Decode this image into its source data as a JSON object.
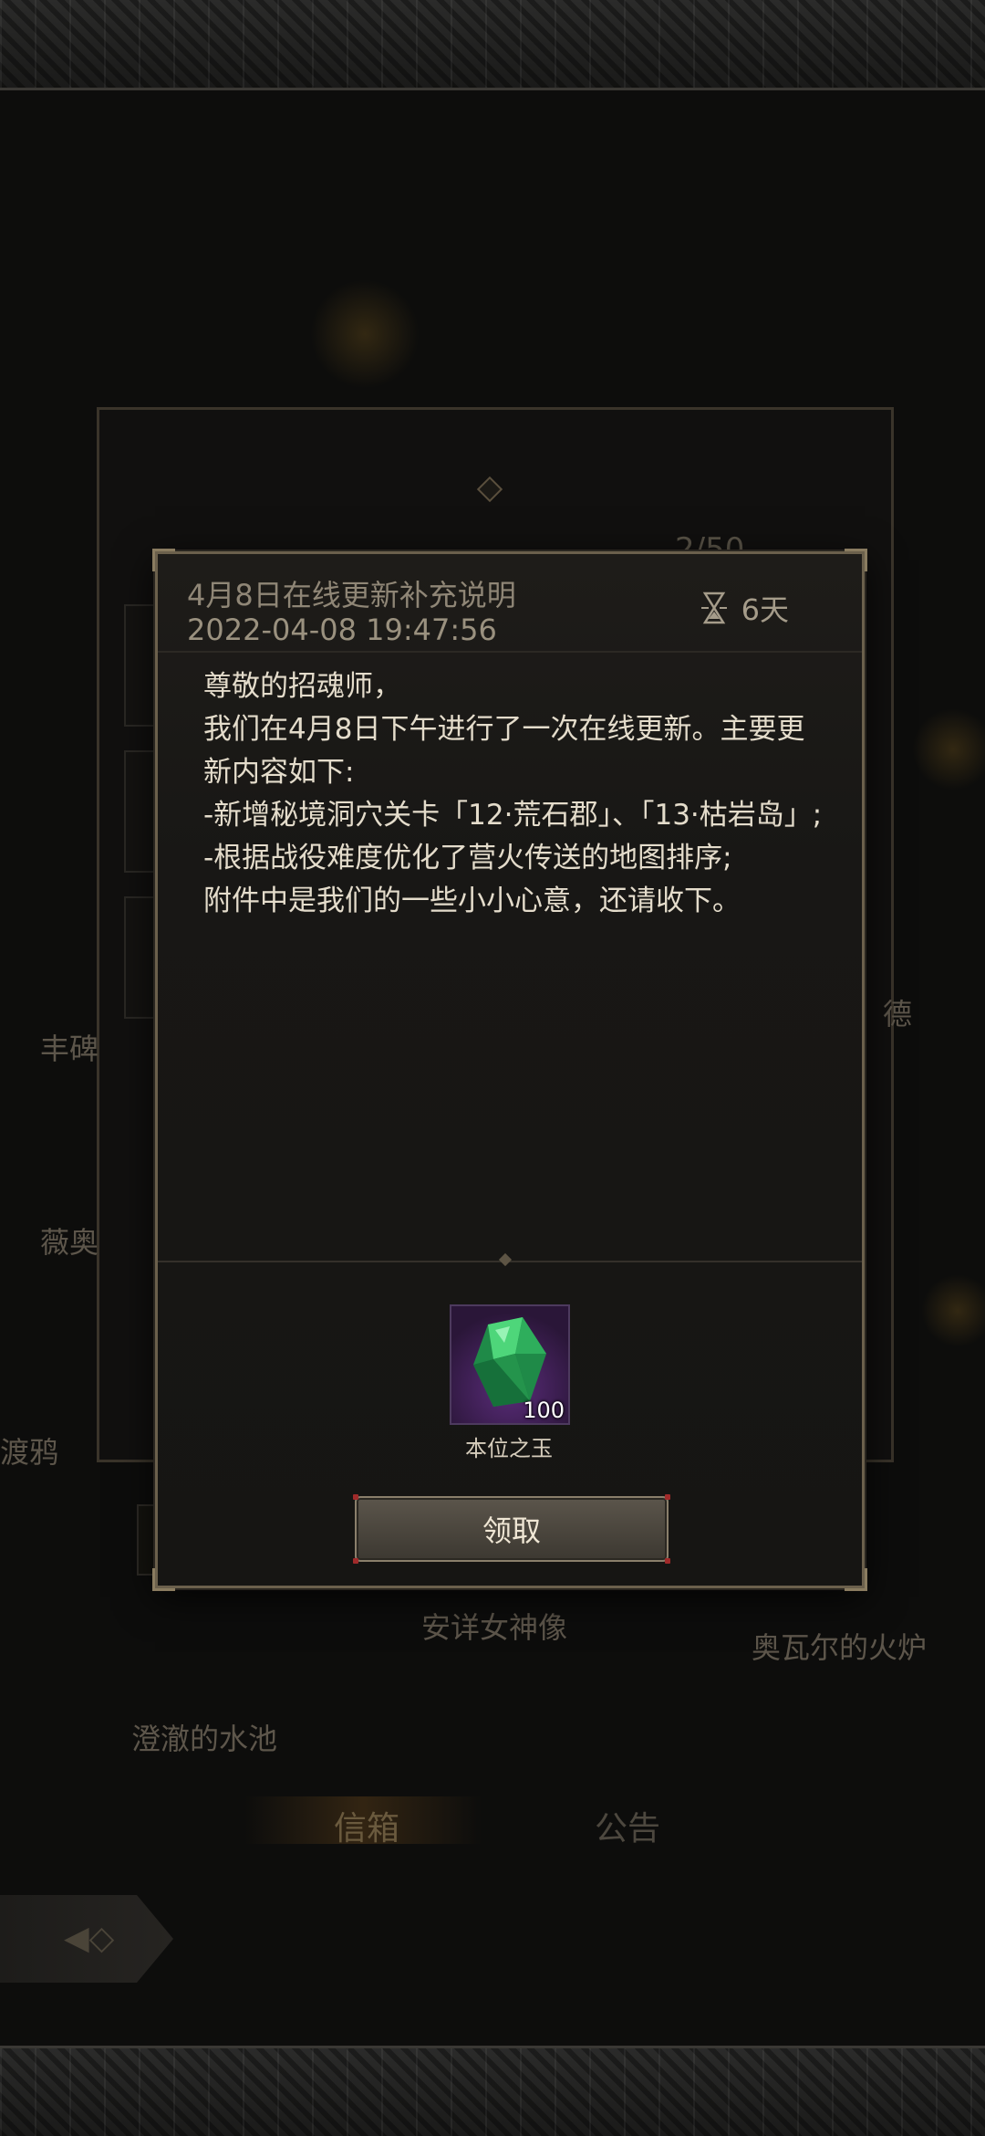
{
  "background": {
    "counter": "2/50",
    "side_labels": [
      "丰碑",
      "薇奥",
      "渡鸦",
      "德"
    ],
    "locations": [
      "安详女神像",
      "奥瓦尔的火炉",
      "澄澈的水池"
    ],
    "tabs": [
      {
        "label": "信箱",
        "active": true
      },
      {
        "label": "公告",
        "active": false
      }
    ],
    "back_icon": "back-arrow-icon"
  },
  "mail": {
    "title": "4月8日在线更新补充说明",
    "date": "2022-04-08 19:47:56",
    "expire_icon": "hourglass-icon",
    "expire_label": "6天",
    "body": [
      "尊敬的招魂师，",
      "我们在4月8日下午进行了一次在线更新。主要更新内容如下:",
      "-新增秘境洞穴关卡「12·荒石郡」、「13·枯岩岛」;",
      "-根据战役难度优化了营火传送的地图排序;",
      "附件中是我们的一些小小心意，还请收下。"
    ],
    "attachment": {
      "name": "本位之玉",
      "count": "100",
      "icon": "green-crystal-icon",
      "rarity_color": "#5a2c7a"
    },
    "claim_label": "领取"
  }
}
